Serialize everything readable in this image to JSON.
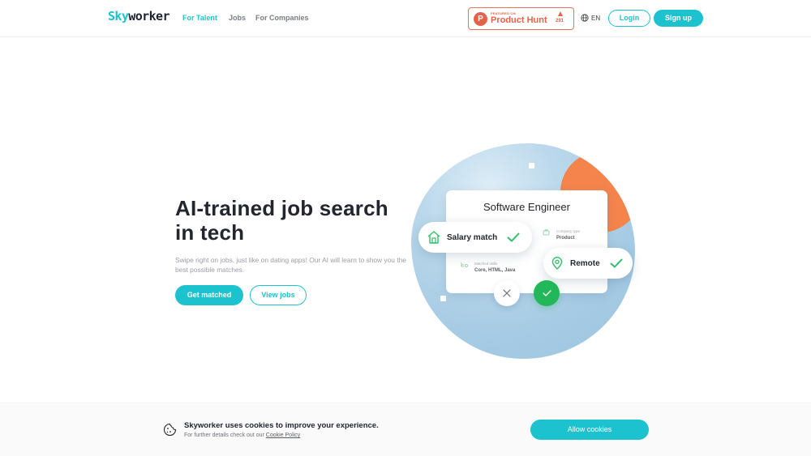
{
  "nav": {
    "logo_part1": "Sky",
    "logo_part2": "worker",
    "links": [
      {
        "label": "For Talent",
        "active": true
      },
      {
        "label": "Jobs",
        "active": false
      },
      {
        "label": "For Companies",
        "active": false
      }
    ],
    "product_hunt": {
      "featured": "FEATURED ON",
      "name": "Product Hunt",
      "letter": "P",
      "count": "291"
    },
    "language": "EN",
    "login_label": "Login",
    "signup_label": "Sign up"
  },
  "hero": {
    "title": "AI-trained job search in tech",
    "subtitle": "Swipe right on jobs, just like on dating apps! Our AI will learn to show you the best possible matches.",
    "primary_cta": "Get matched",
    "secondary_cta": "View jobs"
  },
  "illustration": {
    "card_title": "Software Engineer",
    "salary_pill": "Salary match",
    "remote_pill": "Remote",
    "company_type_label": "Company type",
    "company_type_value": "Product",
    "skills_label": "Matched skills",
    "skills_value": "Core, HTML, Java"
  },
  "cookies": {
    "title": "Skyworker uses cookies to improve your experience.",
    "subtitle": "For further details check out our",
    "policy_link": "Cookie Policy",
    "allow_label": "Allow cookies"
  },
  "colors": {
    "brand": "#1cc3cf",
    "product_hunt": "#e4614a",
    "success": "#22b85a",
    "accent_orange": "#f5844c"
  }
}
